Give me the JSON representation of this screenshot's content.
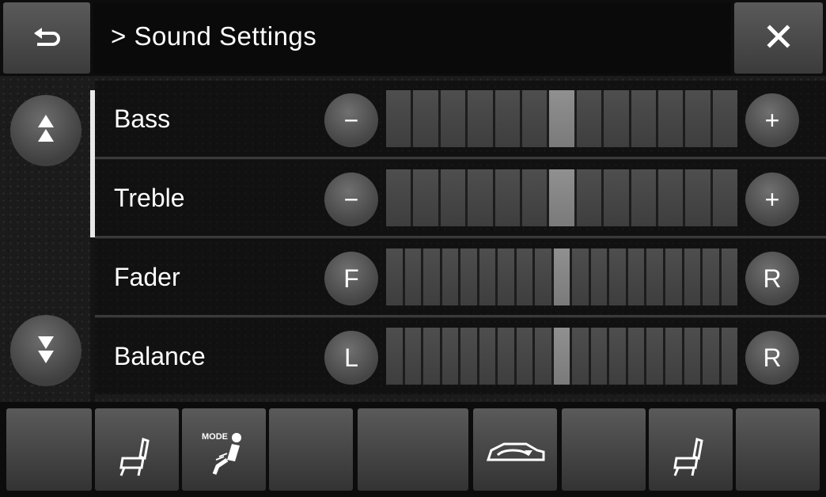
{
  "header": {
    "title": "> Sound Settings",
    "back_icon": "back-arrow-icon",
    "close_icon": "close-icon"
  },
  "sidebar": {
    "scroll_up_icon": "double-arrow-up-icon",
    "scroll_down_icon": "double-arrow-down-icon"
  },
  "settings": [
    {
      "label": "Bass",
      "left": "−",
      "right": "+",
      "segments": 13,
      "level_index": 6
    },
    {
      "label": "Treble",
      "left": "−",
      "right": "+",
      "segments": 13,
      "level_index": 6
    },
    {
      "label": "Fader",
      "left": "F",
      "right": "R",
      "segments": 19,
      "level_index": 9
    },
    {
      "label": "Balance",
      "left": "L",
      "right": "R",
      "segments": 19,
      "level_index": 9
    }
  ],
  "bottom_bar": {
    "buttons": [
      {
        "icon": "blank"
      },
      {
        "icon": "seat-heater-driver-icon"
      },
      {
        "icon": "mode-airflow-icon",
        "text": "MODE"
      },
      {
        "icon": "blank"
      },
      {
        "icon": "blank"
      },
      {
        "icon": "recirculation-icon"
      },
      {
        "icon": "blank"
      },
      {
        "icon": "seat-heater-passenger-icon"
      },
      {
        "icon": "blank"
      }
    ]
  },
  "colors": {
    "background": "#000000",
    "button": "#4a4a4a",
    "segment": "#464646",
    "segment_active": "#858585",
    "text": "#ffffff"
  }
}
